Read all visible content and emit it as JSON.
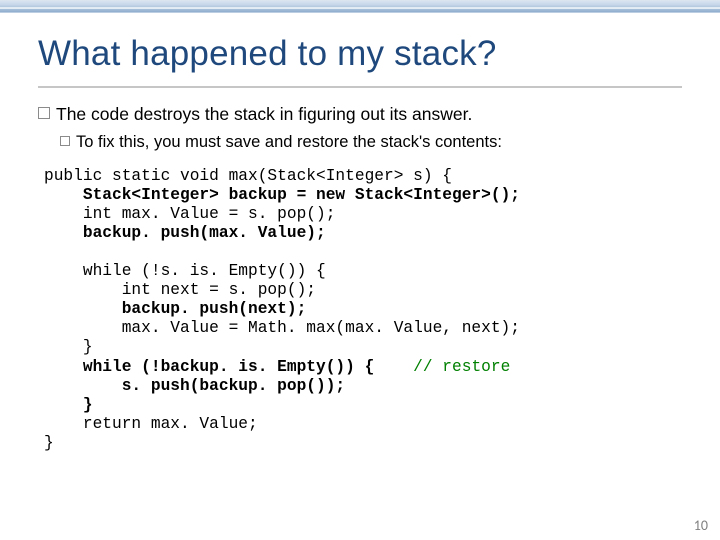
{
  "title": "What happened to my stack?",
  "bullet1": "The code destroys the stack in figuring out its answer.",
  "bullet2": "To fix this, you must save and restore the stack's contents:",
  "code": {
    "l1a": "public static void max(Stack<Integer> s) {",
    "l2a": "    ",
    "l2b": "Stack<Integer> backup = new Stack<Integer>();",
    "l3a": "    int max. Value = s. pop();",
    "l4a": "    ",
    "l4b": "backup. push(max. Value);",
    "blank1": "",
    "l5a": "    while (!s. is. Empty()) {",
    "l6a": "        int next = s. pop();",
    "l7a": "        ",
    "l7b": "backup. push(next);",
    "l8a": "        max. Value = Math. max(max. Value, next);",
    "l9a": "    }",
    "l10a": "    ",
    "l10b": "while (!backup. is. Empty()) {",
    "l10c": "    ",
    "l10d": "// restore",
    "l11a": "        ",
    "l11b": "s. push(backup. pop());",
    "l12a": "    ",
    "l12b": "}",
    "l13a": "    return max. Value;",
    "l14a": "}"
  },
  "page_number": "10"
}
